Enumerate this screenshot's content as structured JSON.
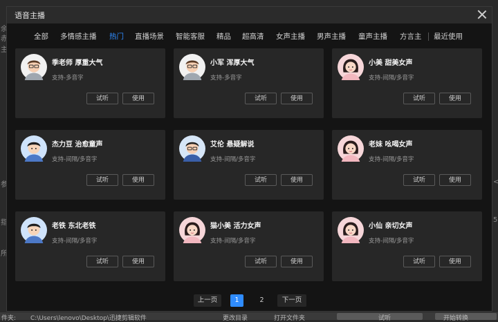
{
  "background": {
    "left_fragments": [
      "余",
      "赤",
      "主",
      "参",
      "指",
      "所"
    ],
    "right_fragments": [
      "<",
      "5"
    ],
    "bottom_label": "件夹:",
    "bottom_path": "C:\\Users\\lenovo\\Desktop\\迅捷剪辑软件",
    "change_dir_button": "更改目录",
    "open_folder_button": "打开文件夹",
    "trial_button": "试听",
    "convert_button": "开始转换"
  },
  "dialog": {
    "title": "语音主播",
    "tabs": [
      "全部",
      "多情感主播",
      "热门",
      "直播场景",
      "智能客服",
      "精品",
      "超高清",
      "女声主播",
      "男声主播",
      "童声主播",
      "方言主",
      "最近使用"
    ],
    "active_tab": "热门",
    "cards": [
      {
        "name": "季老师 厚重大气",
        "support": "支持-多音字",
        "avatar": "male-glasses"
      },
      {
        "name": "小军 浑厚大气",
        "support": "支持-多音字",
        "avatar": "male-glasses"
      },
      {
        "name": "小美 甜美女声",
        "support": "支持-间隔/多音字",
        "avatar": "female"
      },
      {
        "name": "杰力豆 治愈童声",
        "support": "支持-间隔/多音字",
        "avatar": "boy"
      },
      {
        "name": "艾伦 悬疑解说",
        "support": "支持-间隔/多音字",
        "avatar": "male-glasses-blue"
      },
      {
        "name": "老妹 吆喝女声",
        "support": "支持-间隔/多音字",
        "avatar": "female"
      },
      {
        "name": "老铁 东北老铁",
        "support": "支持-间隔/多音字",
        "avatar": "boy"
      },
      {
        "name": "猫小美 活力女声",
        "support": "支持-间隔/多音字",
        "avatar": "female"
      },
      {
        "name": "小仙 亲切女声",
        "support": "支持-间隔/多音字",
        "avatar": "female"
      }
    ],
    "card_buttons": {
      "listen": "试听",
      "use": "使用"
    },
    "pagination": {
      "prev": "上一页",
      "pages": [
        "1",
        "2"
      ],
      "current": "1",
      "next": "下一页"
    }
  },
  "colors": {
    "accent": "#2f8cff",
    "card_bg": "#272727",
    "dialog_bg": "#141414"
  }
}
